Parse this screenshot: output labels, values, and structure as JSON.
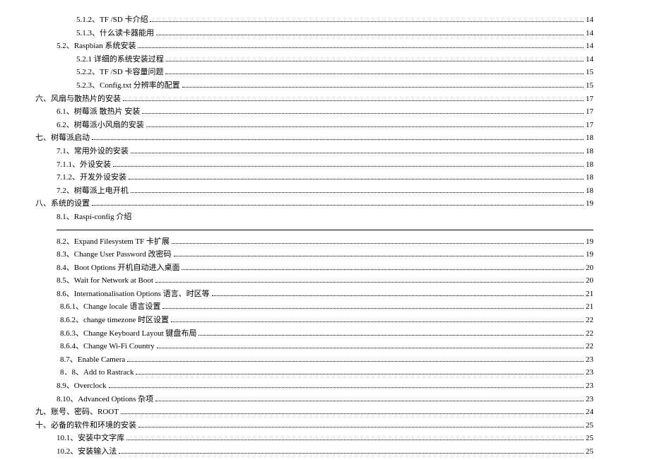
{
  "toc": [
    {
      "level": 2,
      "label": "5.1.2、TF /SD 卡介绍",
      "page": "14"
    },
    {
      "level": 2,
      "label": "5.1.3、什么读卡器能用",
      "page": "14"
    },
    {
      "level": 1,
      "label": "5.2、Raspbian 系统安装",
      "page": "14"
    },
    {
      "level": 2,
      "label": "5.2.1 详细的系统安装过程",
      "page": "14"
    },
    {
      "level": 2,
      "label": "5.2.2、TF /SD 卡容量问题",
      "page": "15"
    },
    {
      "level": 2,
      "label": "5.2.3、Config.txt 分辨率的配置",
      "page": "15"
    },
    {
      "level": 0,
      "label": "六、风扇与散热片的安装",
      "page": "17"
    },
    {
      "level": 1,
      "label": "6.1、树莓派 散热片 安装",
      "page": "17"
    },
    {
      "level": 1,
      "label": "6.2、树莓派小风扇的安装",
      "page": "17"
    },
    {
      "level": 0,
      "label": "七、树莓派启动",
      "page": "18"
    },
    {
      "level": 1,
      "label": "7.1、常用外设的安装",
      "page": "18"
    },
    {
      "level": 1,
      "label": "7.1.1、外设安装",
      "page": "18"
    },
    {
      "level": 1,
      "label": "7.1.2、开发外设安装",
      "page": "18"
    },
    {
      "level": 1,
      "label": "7.2、树莓派上电开机",
      "page": "18"
    },
    {
      "level": 0,
      "label": "八、系统的设置",
      "page": "19"
    },
    {
      "level": 1,
      "label": "8.1、Raspi-config   介绍",
      "page": "",
      "nodots": true
    }
  ],
  "toc2": [
    {
      "level": 1,
      "label": "8.2、Expand Filesystem TF 卡扩展",
      "page": "19"
    },
    {
      "level": 1,
      "label": "8.3、Change User Password   改密码",
      "page": "19"
    },
    {
      "level": 1,
      "label": "8.4、Boot Options 开机自动进入桌面",
      "page": "20"
    },
    {
      "level": 1,
      "label": "8.5、Wait for Network at Boot",
      "page": "20"
    },
    {
      "level": 1,
      "label": "8.6、Internationalisation Options   语言、时区等",
      "page": "21"
    },
    {
      "level": 3,
      "label": "8.6.1、Change locale   语言设置",
      "page": "21"
    },
    {
      "level": 3,
      "label": "8.6.2、change timezone   时区设置",
      "page": "22"
    },
    {
      "level": 3,
      "label": "8.6.3、Change Keyboard Layout 键盘布局",
      "page": "22"
    },
    {
      "level": 3,
      "label": "8.6.4、Change Wi-Fi Country",
      "page": "22"
    },
    {
      "level": 3,
      "label": "8.7、Enable Camera",
      "page": "23"
    },
    {
      "level": 3,
      "label": "8．8、Add to Rastrack",
      "page": "23"
    },
    {
      "level": 1,
      "label": "8.9、Overclock",
      "page": "23"
    },
    {
      "level": 1,
      "label": "8.10、Advanced Options   杂项",
      "page": "23"
    },
    {
      "level": 0,
      "label": "九、账号、密码、ROOT",
      "page": "24"
    },
    {
      "level": 0,
      "label": "十、必备的软件和环境的安装",
      "page": "25"
    },
    {
      "level": 1,
      "label": "10.1、安装中文字库",
      "page": "25"
    },
    {
      "level": 1,
      "label": "10.2、安装输入法",
      "page": "25"
    }
  ]
}
